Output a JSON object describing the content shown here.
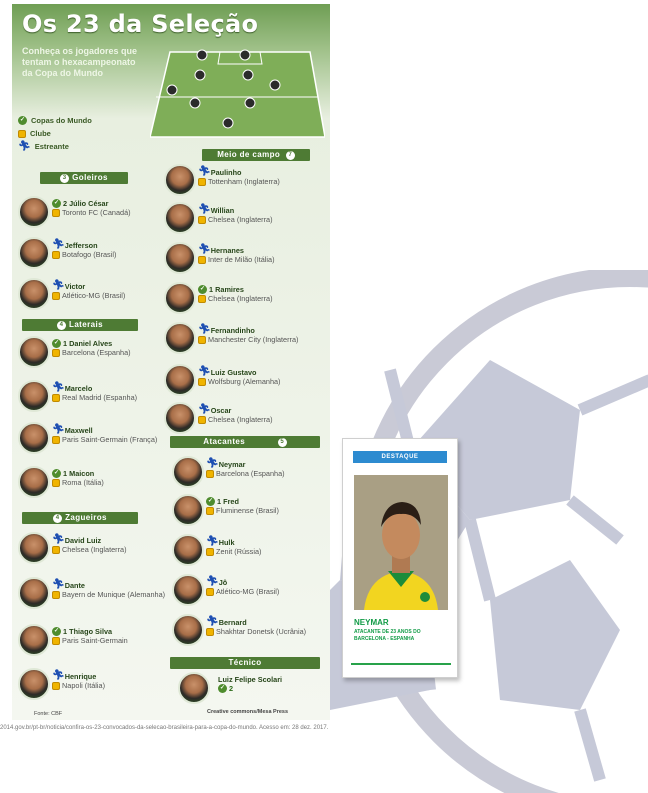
{
  "title": "Os 23 da Seleção",
  "subtitle": "Conheça os jogadores que tentam o hexacampeonato da Copa do Mundo",
  "legend": [
    {
      "icon": "cup-icon",
      "label": "Copas do Mundo"
    },
    {
      "icon": "club-icon",
      "label": "Clube"
    },
    {
      "icon": "runner-icon",
      "label": "Estreante"
    }
  ],
  "sections": {
    "goleiros": {
      "num": "3",
      "label": "Goleiros"
    },
    "laterais": {
      "num": "4",
      "label": "Laterais"
    },
    "zagueiros": {
      "num": "4",
      "label": "Zagueiros"
    },
    "meio": {
      "num": "7",
      "label": "Meio de campo"
    },
    "atacantes": {
      "num": "5",
      "label": "Atacantes"
    },
    "tecnico": {
      "label": "Técnico"
    }
  },
  "goleiros": [
    {
      "name": "2  Júlio César",
      "club": "Toronto FC (Canadá)"
    },
    {
      "name": "Jefferson",
      "club": "Botafogo (Brasil)"
    },
    {
      "name": "Victor",
      "club": "Atlético-MG (Brasil)"
    }
  ],
  "laterais": [
    {
      "name": "1  Daniel Alves",
      "club": "Barcelona (Espanha)"
    },
    {
      "name": "Marcelo",
      "club": "Real Madrid (Espanha)"
    },
    {
      "name": "Maxwell",
      "club": "Paris Saint-Germain (França)"
    },
    {
      "name": "1  Maicon",
      "club": "Roma (Itália)"
    }
  ],
  "zagueiros": [
    {
      "name": "David Luiz",
      "club": "Chelsea (Inglaterra)"
    },
    {
      "name": "Dante",
      "club": "Bayern de Munique (Alemanha)"
    },
    {
      "name": "1  Thiago Silva",
      "club": "Paris Saint-Germain"
    },
    {
      "name": "Henrique",
      "club": "Napoli (Itália)"
    }
  ],
  "meio": [
    {
      "name": "Paulinho",
      "club": "Tottenham (Inglaterra)"
    },
    {
      "name": "Willian",
      "club": "Chelsea (Inglaterra)"
    },
    {
      "name": "Hernanes",
      "club": "Inter de Milão (Itália)"
    },
    {
      "name": "1  Ramires",
      "club": "Chelsea (Inglaterra)"
    },
    {
      "name": "Fernandinho",
      "club": "Manchester City (Inglaterra)"
    },
    {
      "name": "Luiz Gustavo",
      "club": "Wolfsburg (Alemanha)"
    },
    {
      "name": "Oscar",
      "club": "Chelsea (Inglaterra)"
    }
  ],
  "atacantes": [
    {
      "name": "Neymar",
      "club": "Barcelona (Espanha)"
    },
    {
      "name": "1  Fred",
      "club": "Fluminense (Brasil)"
    },
    {
      "name": "Hulk",
      "club": "Zenit (Rússia)"
    },
    {
      "name": "Jô",
      "club": "Atlético-MG (Brasil)"
    },
    {
      "name": "Bernard",
      "club": "Shakhtar Donetsk (Ucrânia)"
    }
  ],
  "tecnico": {
    "name": "Luiz Felipe Scolari",
    "cups": "2"
  },
  "credits": {
    "source": "Fonte: CBF",
    "license": "Creative commons/Mesa Press"
  },
  "card": {
    "tag": "DESTAQUE",
    "name": "NEYMAR",
    "desc": "ATACANTE DE 23 ANOS DO BARCELONA - ESPANHA"
  },
  "source_note": "2014.gov.br/pt-br/noticia/confira-os-23-convocados-da-selecao-brasileira-para-a-copa-do-mundo. Acesso em: 28 dez. 2017.",
  "colors": {
    "accent_green": "#4e7b34",
    "card_blue": "#2d8bd0",
    "card_green": "#119b46"
  }
}
